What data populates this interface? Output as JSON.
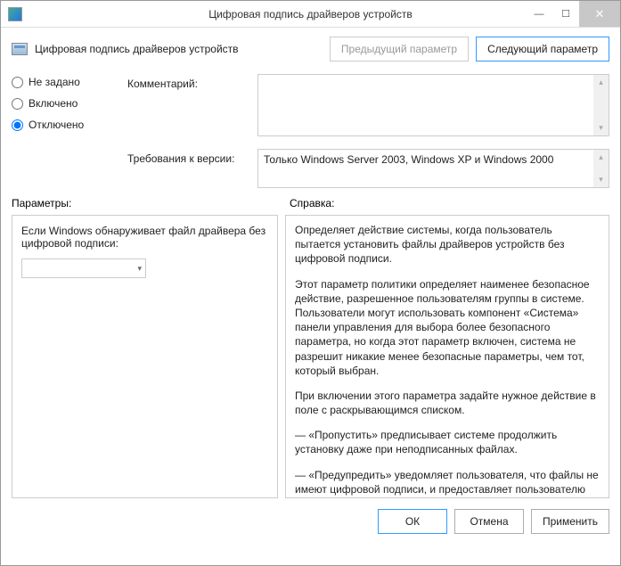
{
  "window": {
    "title": "Цифровая подпись драйверов устройств"
  },
  "header": {
    "title": "Цифровая подпись драйверов устройств",
    "prev_btn": "Предыдущий параметр",
    "next_btn": "Следующий параметр"
  },
  "radios": {
    "not_configured": "Не задано",
    "enabled": "Включено",
    "disabled": "Отключено",
    "selected": "disabled"
  },
  "labels": {
    "comment": "Комментарий:",
    "requirements": "Требования к версии:",
    "parameters": "Параметры:",
    "help": "Справка:"
  },
  "requirements_text": "Только Windows Server 2003, Windows XP и Windows 2000",
  "params_panel": {
    "message": "Если Windows обнаруживает файл драйвера без цифровой подписи:"
  },
  "help_panel": {
    "p1": "Определяет действие системы, когда пользователь пытается установить файлы драйверов устройств без цифровой подписи.",
    "p2": "Этот параметр политики определяет наименее безопасное действие, разрешенное пользователям группы в системе. Пользователи могут использовать компонент «Система» панели управления для выбора более безопасного параметра, но когда этот параметр включен, система не разрешит никакие менее безопасные параметры, чем тот, который выбран.",
    "p3": "При включении этого параметра задайте нужное действие в поле с раскрывающимся списком.",
    "p4": "— «Пропустить» предписывает системе продолжить установку даже при неподписанных файлах.",
    "p5": "— «Предупредить» уведомляет пользователя, что файлы не имеют цифровой подписи, и предоставляет пользователю"
  },
  "footer": {
    "ok": "ОК",
    "cancel": "Отмена",
    "apply": "Применить"
  }
}
